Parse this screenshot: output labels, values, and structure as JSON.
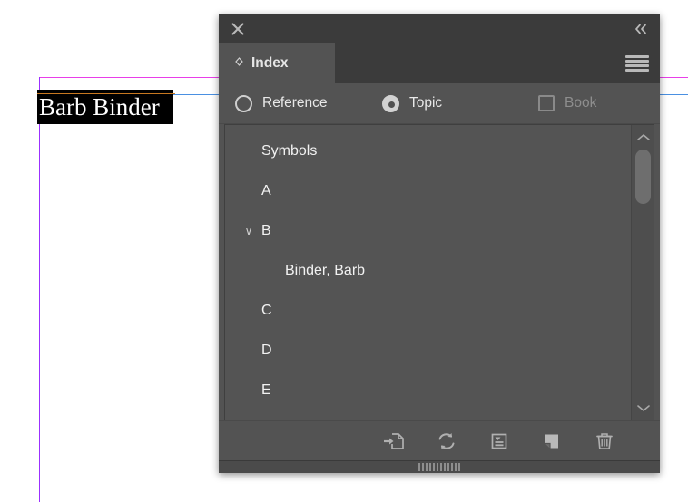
{
  "document": {
    "selected_text": "Barb Binder",
    "guides": {
      "margin_color": "#9b30ff",
      "bleed_color": "#e83fe8",
      "baseline_color": "#4a90e2",
      "frame_color": "#c87820"
    }
  },
  "panel": {
    "close_label": "×",
    "collapse_label": "«",
    "menu_label": "panel-menu",
    "tab": {
      "title": "Index",
      "grip": "◇"
    },
    "options": [
      {
        "name": "reference",
        "label": "Reference",
        "type": "radio",
        "selected": false,
        "disabled": false
      },
      {
        "name": "topic",
        "label": "Topic",
        "type": "radio",
        "selected": true,
        "disabled": false
      },
      {
        "name": "book",
        "label": "Book",
        "type": "checkbox",
        "selected": false,
        "disabled": true
      }
    ],
    "list": [
      {
        "label": "Symbols",
        "level": 0,
        "twisty": ""
      },
      {
        "label": "A",
        "level": 0,
        "twisty": ""
      },
      {
        "label": "B",
        "level": 0,
        "twisty": "∨"
      },
      {
        "label": "Binder, Barb",
        "level": 1,
        "twisty": ""
      },
      {
        "label": "C",
        "level": 0,
        "twisty": ""
      },
      {
        "label": "D",
        "level": 0,
        "twisty": ""
      },
      {
        "label": "E",
        "level": 0,
        "twisty": ""
      }
    ],
    "scrollbar": {
      "up_arrow": "∧",
      "down_arrow": "∨"
    },
    "toolbar": [
      {
        "name": "new-entry-from-selection-icon",
        "title": "Create new index entry from selection"
      },
      {
        "name": "update-preview-icon",
        "title": "Update Preview"
      },
      {
        "name": "generate-index-icon",
        "title": "Generate Index"
      },
      {
        "name": "new-entry-icon",
        "title": "Create a new index entry"
      },
      {
        "name": "delete-entry-icon",
        "title": "Delete selected entry"
      }
    ],
    "colors": {
      "panel_bg": "#535353",
      "header_bg": "#3b3b3b",
      "list_bg": "#545454",
      "text": "#f2f2f2",
      "muted_text": "#8e8e8e"
    }
  }
}
